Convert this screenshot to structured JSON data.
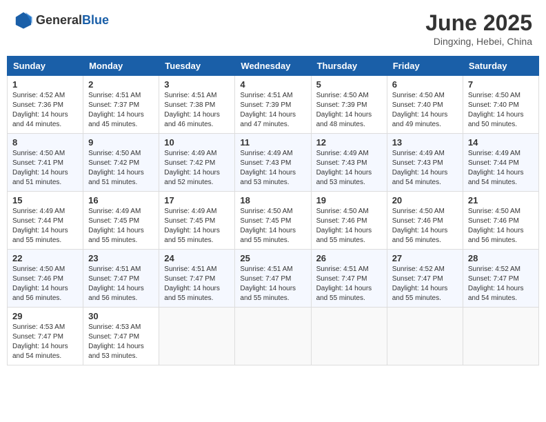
{
  "header": {
    "logo_general": "General",
    "logo_blue": "Blue",
    "month_year": "June 2025",
    "location": "Dingxing, Hebei, China"
  },
  "weekdays": [
    "Sunday",
    "Monday",
    "Tuesday",
    "Wednesday",
    "Thursday",
    "Friday",
    "Saturday"
  ],
  "weeks": [
    [
      {
        "day": "1",
        "sunrise": "4:52 AM",
        "sunset": "7:36 PM",
        "daylight": "14 hours and 44 minutes."
      },
      {
        "day": "2",
        "sunrise": "4:51 AM",
        "sunset": "7:37 PM",
        "daylight": "14 hours and 45 minutes."
      },
      {
        "day": "3",
        "sunrise": "4:51 AM",
        "sunset": "7:38 PM",
        "daylight": "14 hours and 46 minutes."
      },
      {
        "day": "4",
        "sunrise": "4:51 AM",
        "sunset": "7:39 PM",
        "daylight": "14 hours and 47 minutes."
      },
      {
        "day": "5",
        "sunrise": "4:50 AM",
        "sunset": "7:39 PM",
        "daylight": "14 hours and 48 minutes."
      },
      {
        "day": "6",
        "sunrise": "4:50 AM",
        "sunset": "7:40 PM",
        "daylight": "14 hours and 49 minutes."
      },
      {
        "day": "7",
        "sunrise": "4:50 AM",
        "sunset": "7:40 PM",
        "daylight": "14 hours and 50 minutes."
      }
    ],
    [
      {
        "day": "8",
        "sunrise": "4:50 AM",
        "sunset": "7:41 PM",
        "daylight": "14 hours and 51 minutes."
      },
      {
        "day": "9",
        "sunrise": "4:50 AM",
        "sunset": "7:42 PM",
        "daylight": "14 hours and 51 minutes."
      },
      {
        "day": "10",
        "sunrise": "4:49 AM",
        "sunset": "7:42 PM",
        "daylight": "14 hours and 52 minutes."
      },
      {
        "day": "11",
        "sunrise": "4:49 AM",
        "sunset": "7:43 PM",
        "daylight": "14 hours and 53 minutes."
      },
      {
        "day": "12",
        "sunrise": "4:49 AM",
        "sunset": "7:43 PM",
        "daylight": "14 hours and 53 minutes."
      },
      {
        "day": "13",
        "sunrise": "4:49 AM",
        "sunset": "7:43 PM",
        "daylight": "14 hours and 54 minutes."
      },
      {
        "day": "14",
        "sunrise": "4:49 AM",
        "sunset": "7:44 PM",
        "daylight": "14 hours and 54 minutes."
      }
    ],
    [
      {
        "day": "15",
        "sunrise": "4:49 AM",
        "sunset": "7:44 PM",
        "daylight": "14 hours and 55 minutes."
      },
      {
        "day": "16",
        "sunrise": "4:49 AM",
        "sunset": "7:45 PM",
        "daylight": "14 hours and 55 minutes."
      },
      {
        "day": "17",
        "sunrise": "4:49 AM",
        "sunset": "7:45 PM",
        "daylight": "14 hours and 55 minutes."
      },
      {
        "day": "18",
        "sunrise": "4:50 AM",
        "sunset": "7:45 PM",
        "daylight": "14 hours and 55 minutes."
      },
      {
        "day": "19",
        "sunrise": "4:50 AM",
        "sunset": "7:46 PM",
        "daylight": "14 hours and 55 minutes."
      },
      {
        "day": "20",
        "sunrise": "4:50 AM",
        "sunset": "7:46 PM",
        "daylight": "14 hours and 56 minutes."
      },
      {
        "day": "21",
        "sunrise": "4:50 AM",
        "sunset": "7:46 PM",
        "daylight": "14 hours and 56 minutes."
      }
    ],
    [
      {
        "day": "22",
        "sunrise": "4:50 AM",
        "sunset": "7:46 PM",
        "daylight": "14 hours and 56 minutes."
      },
      {
        "day": "23",
        "sunrise": "4:51 AM",
        "sunset": "7:47 PM",
        "daylight": "14 hours and 56 minutes."
      },
      {
        "day": "24",
        "sunrise": "4:51 AM",
        "sunset": "7:47 PM",
        "daylight": "14 hours and 55 minutes."
      },
      {
        "day": "25",
        "sunrise": "4:51 AM",
        "sunset": "7:47 PM",
        "daylight": "14 hours and 55 minutes."
      },
      {
        "day": "26",
        "sunrise": "4:51 AM",
        "sunset": "7:47 PM",
        "daylight": "14 hours and 55 minutes."
      },
      {
        "day": "27",
        "sunrise": "4:52 AM",
        "sunset": "7:47 PM",
        "daylight": "14 hours and 55 minutes."
      },
      {
        "day": "28",
        "sunrise": "4:52 AM",
        "sunset": "7:47 PM",
        "daylight": "14 hours and 54 minutes."
      }
    ],
    [
      {
        "day": "29",
        "sunrise": "4:53 AM",
        "sunset": "7:47 PM",
        "daylight": "14 hours and 54 minutes."
      },
      {
        "day": "30",
        "sunrise": "4:53 AM",
        "sunset": "7:47 PM",
        "daylight": "14 hours and 53 minutes."
      },
      null,
      null,
      null,
      null,
      null
    ]
  ]
}
